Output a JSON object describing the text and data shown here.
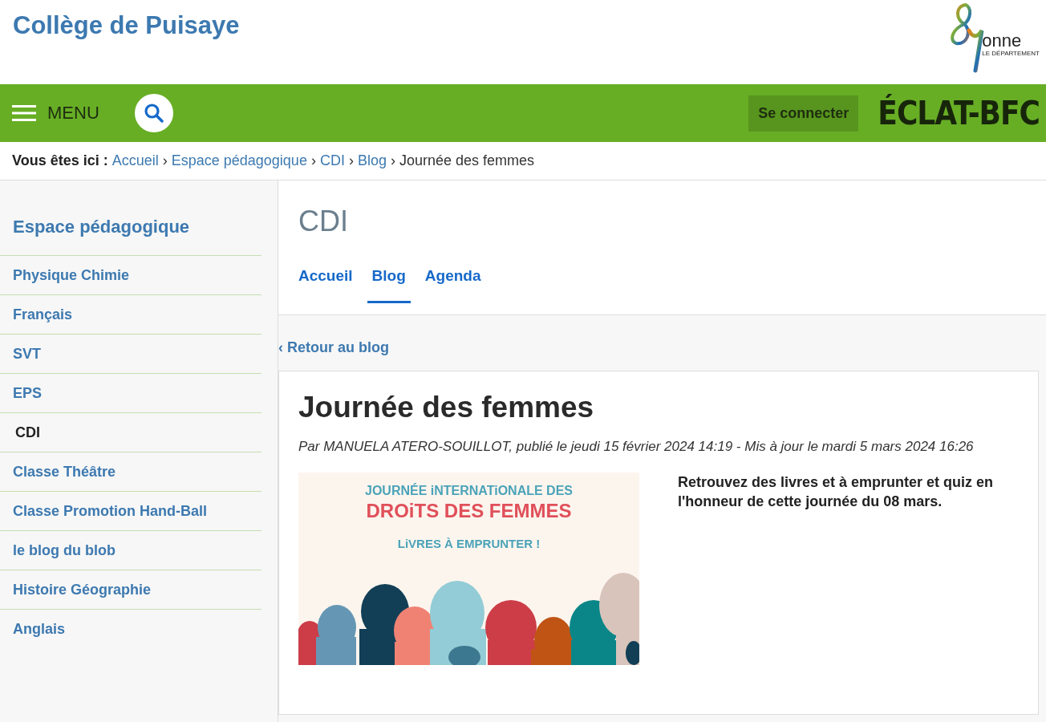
{
  "header": {
    "site_title": "Collège de Puisaye",
    "logo": {
      "word": "onne",
      "subtitle": "LE DÉPARTEMENT"
    }
  },
  "navbar": {
    "menu_label": "MENU",
    "login_button": "Se connecter",
    "partner_logo": "ÉCLAT-BFC"
  },
  "breadcrumb": {
    "label": "Vous êtes ici :",
    "separator": "›",
    "links": [
      "Accueil",
      "Espace pédagogique",
      "CDI",
      "Blog"
    ],
    "current": "Journée des femmes"
  },
  "sidebar": {
    "title": "Espace pédagogique",
    "items": [
      {
        "label": "Physique Chimie",
        "selected": false
      },
      {
        "label": "Français",
        "selected": false
      },
      {
        "label": "SVT",
        "selected": false
      },
      {
        "label": "EPS",
        "selected": false
      },
      {
        "label": "CDI",
        "selected": true
      },
      {
        "label": "Classe Théâtre",
        "selected": false
      },
      {
        "label": "Classe Promotion Hand-Ball",
        "selected": false
      },
      {
        "label": "le blog du blob",
        "selected": false
      },
      {
        "label": "Histoire Géographie",
        "selected": false
      },
      {
        "label": "Anglais",
        "selected": false
      }
    ]
  },
  "section": {
    "title": "CDI",
    "tabs": [
      {
        "label": "Accueil",
        "selected": false
      },
      {
        "label": "Blog",
        "selected": true
      },
      {
        "label": "Agenda",
        "selected": false
      }
    ]
  },
  "back_link": "‹ Retour au blog",
  "article": {
    "title": "Journée des femmes",
    "meta": "Par MANUELA ATERO-SOUILLOT, publié le jeudi 15 février 2024 14:19 - Mis à jour le mardi 5 mars 2024 16:26",
    "poster": {
      "line_1": "JOURNÉE iNTERNATiONALE DES",
      "line_2": "DROiTS DES FEMMES",
      "line_3": "LiVRES À EMPRUNTER !"
    },
    "body": "Retrouvez des livres et à emprunter et quiz en l'honneur de cette journée du 08 mars."
  }
}
